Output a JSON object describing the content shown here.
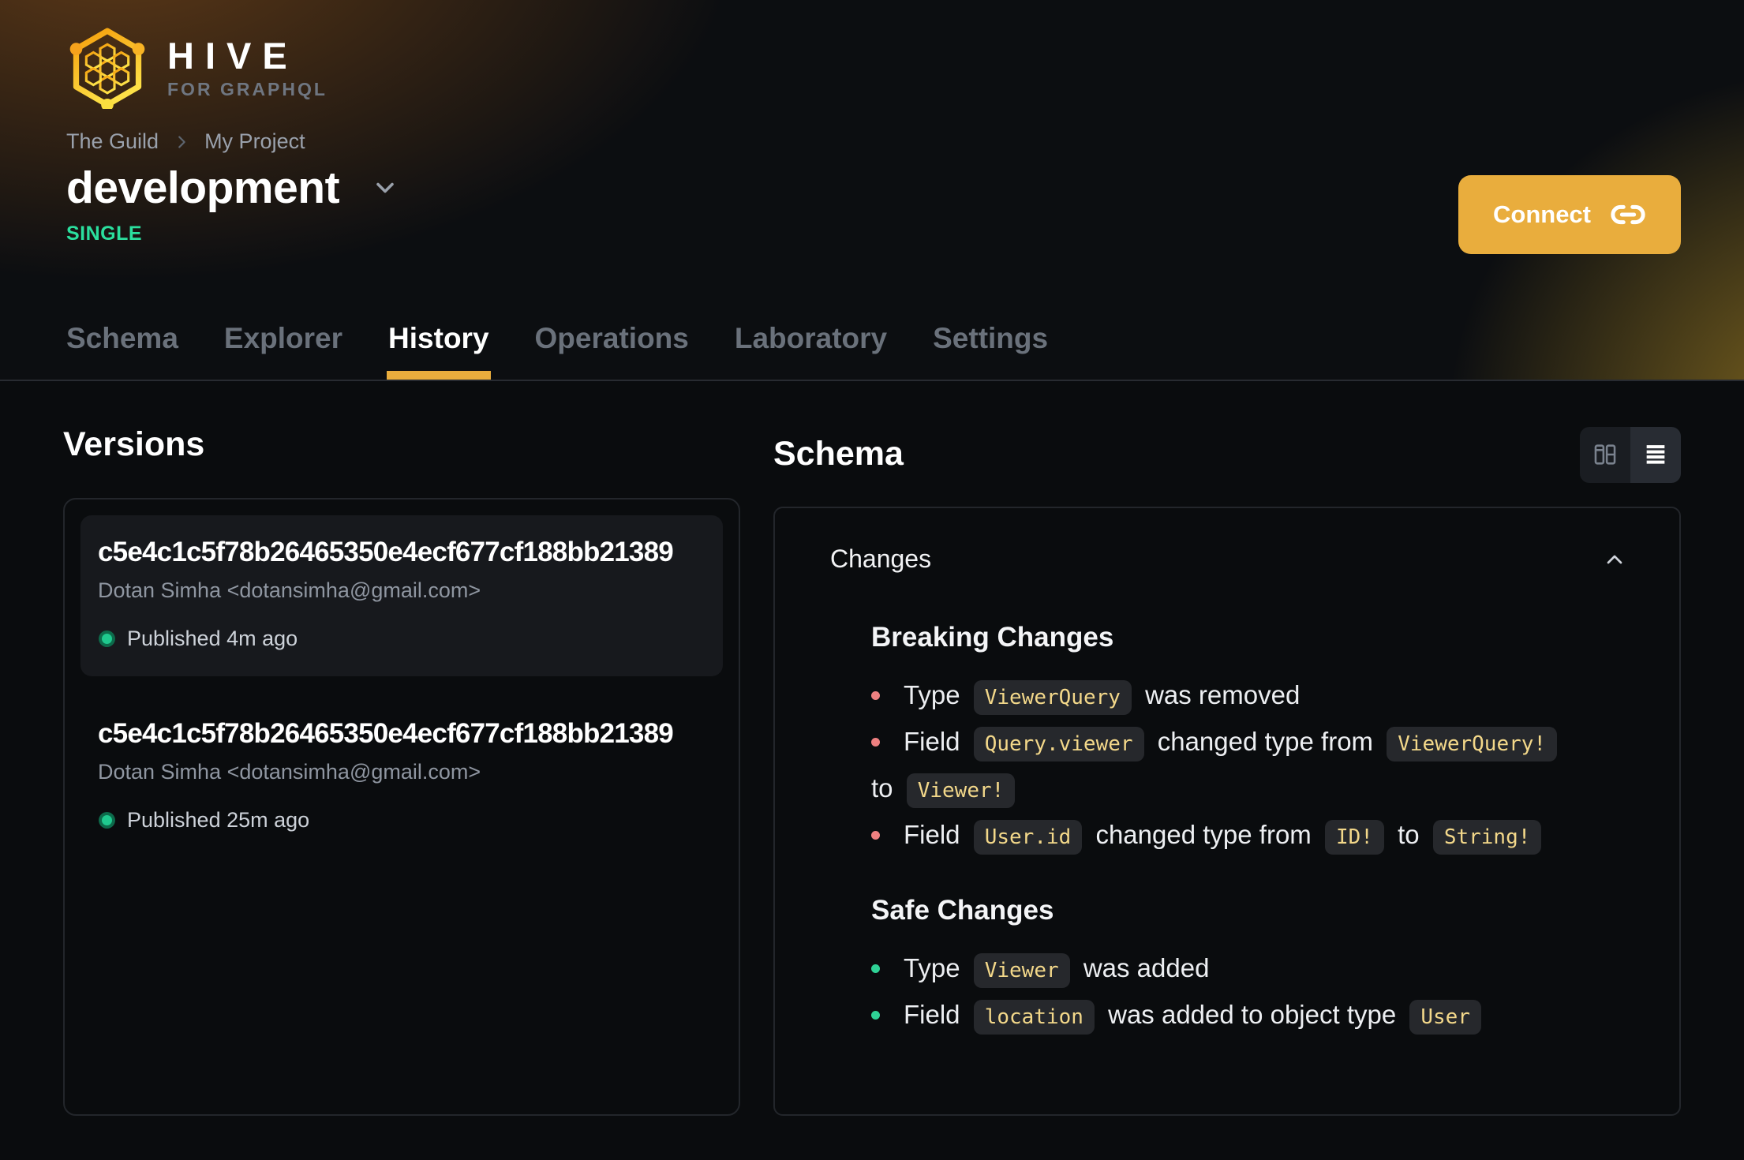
{
  "header": {
    "brand": {
      "name": "HIVE",
      "tagline": "FOR GRAPHQL"
    },
    "breadcrumb": [
      "The Guild",
      "My Project"
    ],
    "target": {
      "name": "development",
      "badge": "SINGLE"
    },
    "connect_label": "Connect",
    "tabs": [
      {
        "label": "Schema",
        "active": false
      },
      {
        "label": "Explorer",
        "active": false
      },
      {
        "label": "History",
        "active": true
      },
      {
        "label": "Operations",
        "active": false
      },
      {
        "label": "Laboratory",
        "active": false
      },
      {
        "label": "Settings",
        "active": false
      }
    ]
  },
  "versions": {
    "title": "Versions",
    "items": [
      {
        "hash": "c5e4c1c5f78b26465350e4ecf677cf188bb21389",
        "author": "Dotan Simha <dotansimha@gmail.com>",
        "status": "Published 4m ago",
        "selected": true
      },
      {
        "hash": "c5e4c1c5f78b26465350e4ecf677cf188bb21389",
        "author": "Dotan Simha <dotansimha@gmail.com>",
        "status": "Published 25m ago",
        "selected": false
      }
    ]
  },
  "schema_panel": {
    "title": "Schema",
    "view_toggle": [
      {
        "icon": "columns-icon",
        "active": false
      },
      {
        "icon": "list-icon",
        "active": true
      }
    ],
    "changes_label": "Changes",
    "sections": [
      {
        "title": "Breaking Changes",
        "kind": "breaking",
        "items": [
          {
            "parts": [
              [
                "text",
                "Type"
              ],
              [
                "code",
                "ViewerQuery"
              ],
              [
                "text",
                "was removed"
              ]
            ]
          },
          {
            "parts": [
              [
                "text",
                "Field"
              ],
              [
                "code",
                "Query.viewer"
              ],
              [
                "text",
                "changed type from"
              ],
              [
                "code",
                "ViewerQuery!"
              ],
              [
                "br",
                ""
              ],
              [
                "text",
                "to"
              ],
              [
                "code",
                "Viewer!"
              ]
            ]
          },
          {
            "parts": [
              [
                "text",
                "Field"
              ],
              [
                "code",
                "User.id"
              ],
              [
                "text",
                "changed type from"
              ],
              [
                "code",
                "ID!"
              ],
              [
                "text",
                "to"
              ],
              [
                "code",
                "String!"
              ]
            ]
          }
        ]
      },
      {
        "title": "Safe Changes",
        "kind": "safe",
        "items": [
          {
            "parts": [
              [
                "text",
                "Type"
              ],
              [
                "code",
                "Viewer"
              ],
              [
                "text",
                "was added"
              ]
            ]
          },
          {
            "parts": [
              [
                "text",
                "Field"
              ],
              [
                "code",
                "location"
              ],
              [
                "text",
                "was added to object type"
              ],
              [
                "code",
                "User"
              ]
            ]
          }
        ]
      }
    ]
  },
  "colors": {
    "accent": "#e9ad3d",
    "badge_green": "#2bdf9e",
    "breaking_bullet": "#ee8080",
    "safe_bullet": "#2fd296",
    "chip_bg": "#26282c",
    "chip_text": "#f3d88a"
  }
}
